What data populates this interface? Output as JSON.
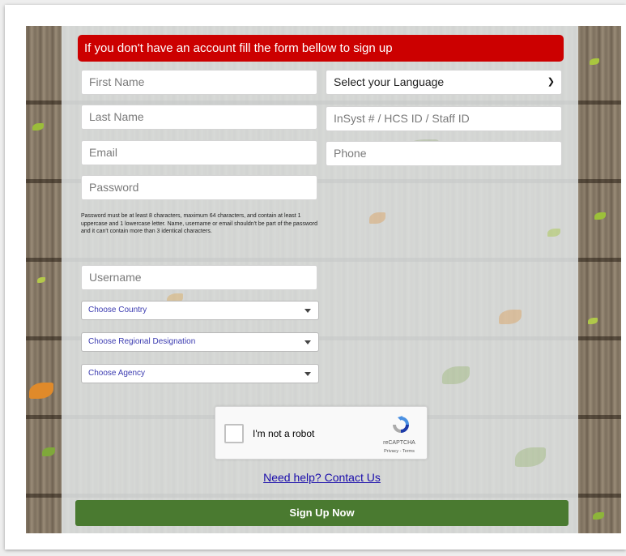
{
  "banner": {
    "text": "If you don't have an account fill the form bellow to sign up"
  },
  "fields": {
    "first_name_placeholder": "First Name",
    "last_name_placeholder": "Last Name",
    "email_placeholder": "Email",
    "password_placeholder": "Password",
    "username_placeholder": "Username",
    "insyst_placeholder": "InSyst # / HCS ID / Staff ID",
    "phone_placeholder": "Phone",
    "language_selected": "Select your Language"
  },
  "password_hint": "Password must be at least 8 characters, maximum 64 characters, and contain at least 1 uppercase and 1 lowercase letter. Name, username or email shouldn't be part of the password and it can't contain more than 3 identical characters.",
  "dropdowns": {
    "country": "Choose Country",
    "region": "Choose Regional Designation",
    "agency": "Choose Agency"
  },
  "captcha": {
    "label": "I'm not a robot",
    "brand": "reCAPTCHA",
    "links": "Privacy - Terms"
  },
  "help_link": "Need help? Contact Us",
  "submit_label": "Sign Up Now",
  "colors": {
    "banner": "#cc0000",
    "submit": "#4a7a30",
    "link": "#1a0dab"
  }
}
